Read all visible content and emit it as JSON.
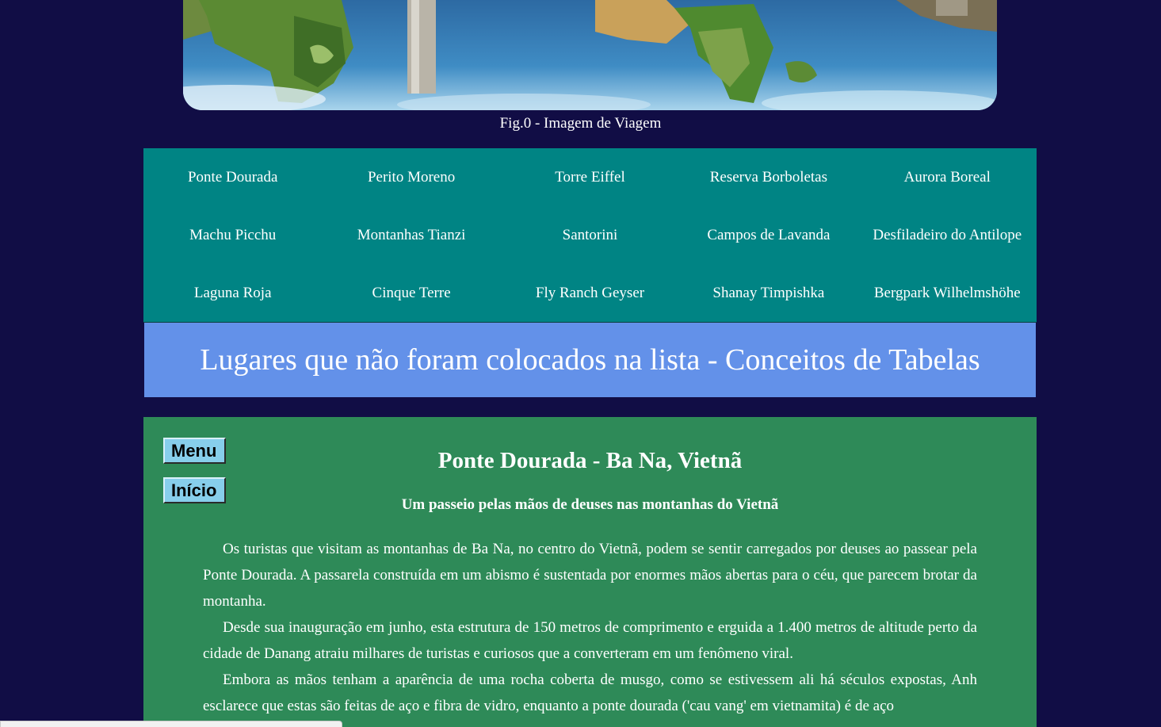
{
  "hero": {
    "caption": "Fig.0 - Imagem de Viagem"
  },
  "nav": {
    "items": [
      "Ponte Dourada",
      "Perito Moreno",
      "Torre Eiffel",
      "Reserva Borboletas",
      "Aurora Boreal",
      "Machu Picchu",
      "Montanhas Tianzi",
      "Santorini",
      "Campos de Lavanda",
      "Desfiladeiro do Antilope",
      "Laguna Roja",
      "Cinque Terre",
      "Fly Ranch Geyser",
      "Shanay Timpishka",
      "Bergpark Wilhelmshöhe"
    ]
  },
  "banner": {
    "title": "Lugares que não foram colocados na lista - Conceitos de Tabelas"
  },
  "sidebar": {
    "menu_label": "Menu",
    "home_label": "Início"
  },
  "article": {
    "title": "Ponte Dourada - Ba Na, Vietnã",
    "subtitle": "Um passeio pelas mãos de deuses nas montanhas do Vietnã",
    "paragraphs": [
      "Os turistas que visitam as montanhas de Ba Na, no centro do Vietnã, podem se sentir carregados por deuses ao passear pela Ponte Dourada. A passarela construída em um abismo é sustentada por enormes mãos abertas para o céu, que parecem brotar da montanha.",
      "Desde sua inauguração em junho, esta estrutura de 150 metros de comprimento e erguida a 1.400 metros de altitude perto da cidade de Danang atraiu milhares de turistas e curiosos que a converteram em um fenômeno viral.",
      "Embora as mãos tenham a aparência de uma rocha coberta de musgo, como se estivessem ali há séculos expostas, Anh esclarece que estas são feitas de aço e fibra de vidro, enquanto a ponte dourada ('cau vang' em vietnamita) é de aço"
    ]
  },
  "colors": {
    "page_background": "#110d45",
    "nav_background": "#008484",
    "banner_background": "#6391e9",
    "content_background": "#2e8a58",
    "button_background": "#87ceeb"
  }
}
